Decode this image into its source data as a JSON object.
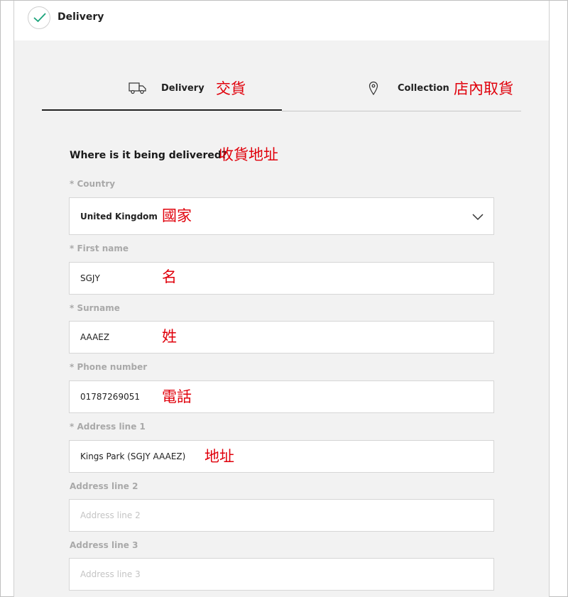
{
  "step": {
    "label": "Delivery",
    "icon": "checkmark-icon"
  },
  "tabs": [
    {
      "label": "Delivery",
      "annotation": "交貨",
      "icon": "truck-icon",
      "active": true
    },
    {
      "label": "Collection",
      "annotation": "店內取貨",
      "icon": "map-pin-icon",
      "active": false
    }
  ],
  "form": {
    "heading": "Where is it being delivered?",
    "heading_annotation": "收貨地址",
    "country": {
      "label": "* Country",
      "value": "United Kingdom",
      "annotation": "國家"
    },
    "first_name": {
      "label": "* First name",
      "value": "SGJY",
      "annotation": "名"
    },
    "surname": {
      "label": "* Surname",
      "value": "AAAEZ",
      "annotation": "姓"
    },
    "phone": {
      "label": "* Phone number",
      "value": "01787269051",
      "annotation": "電話"
    },
    "address1": {
      "label": "* Address line 1",
      "value": "Kings Park  (SGJY AAAEZ)",
      "annotation": "地址"
    },
    "address2": {
      "label": "Address line 2",
      "placeholder": "Address line 2"
    },
    "address3": {
      "label": "Address line 3",
      "placeholder": "Address line 3"
    }
  },
  "colors": {
    "accent_check": "#1aa37a",
    "annotation": "#e0000b",
    "panel_bg": "#f2f2f2"
  }
}
